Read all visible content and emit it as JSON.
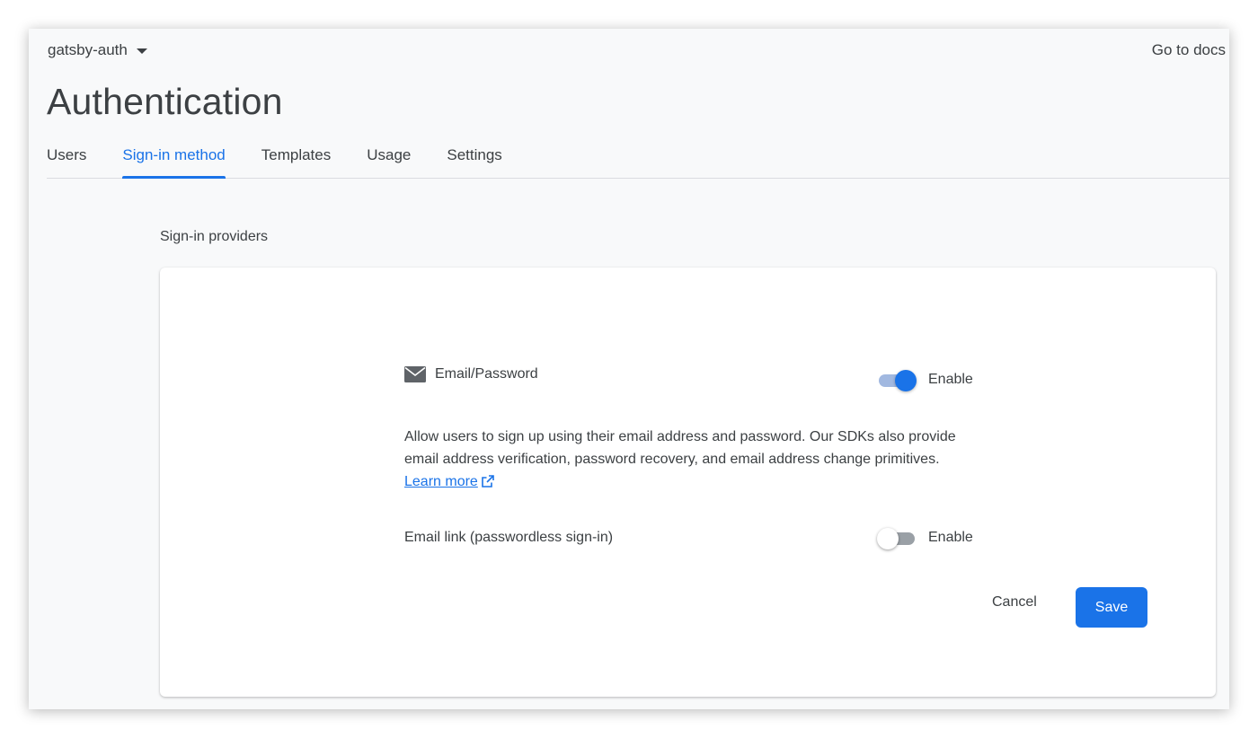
{
  "header": {
    "project_name": "gatsby-auth",
    "docs_link": "Go to docs"
  },
  "page": {
    "title": "Authentication"
  },
  "tabs": [
    {
      "label": "Users",
      "active": false
    },
    {
      "label": "Sign-in method",
      "active": true
    },
    {
      "label": "Templates",
      "active": false
    },
    {
      "label": "Usage",
      "active": false
    },
    {
      "label": "Settings",
      "active": false
    }
  ],
  "section": {
    "label": "Sign-in providers"
  },
  "provider": {
    "icon": "mail-icon",
    "name": "Email/Password",
    "enabled": true,
    "enable_label": "Enable",
    "description": "Allow users to sign up using their email address and password. Our SDKs also provide email address verification, password recovery, and email address change primitives.",
    "learn_more": "Learn more"
  },
  "email_link": {
    "label": "Email link (passwordless sign-in)",
    "enabled": false,
    "enable_label": "Enable"
  },
  "actions": {
    "cancel": "Cancel",
    "save": "Save"
  },
  "colors": {
    "accent": "#1a73e8",
    "background": "#f8f9fa",
    "text": "#3c4043"
  }
}
